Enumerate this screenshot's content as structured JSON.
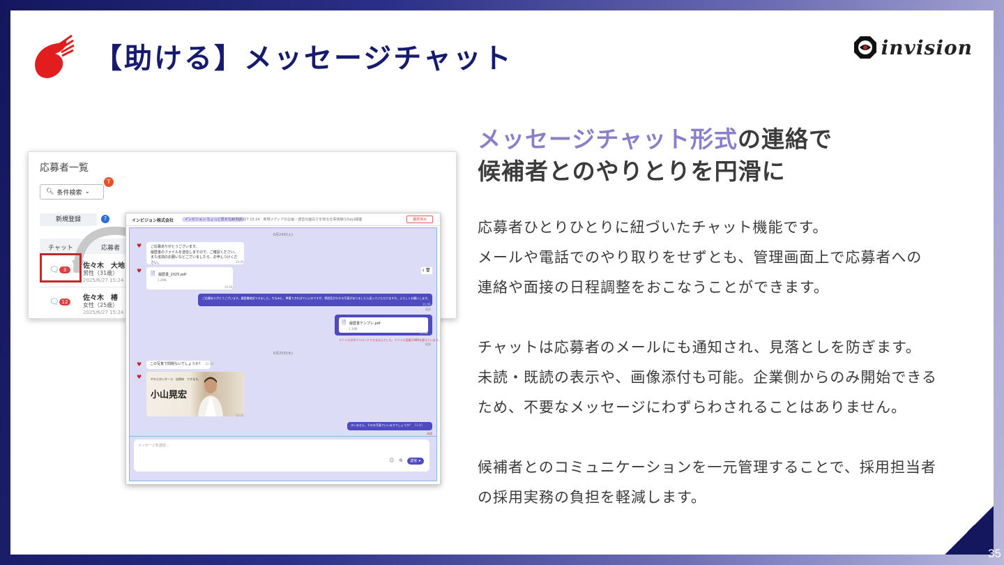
{
  "slide": {
    "title": "【助ける】メッセージチャット",
    "brand": "invision",
    "page_number": "35",
    "colors": {
      "navy": "#161b6e",
      "accent": "#8b7fc9",
      "logo_red": "#e11d1d"
    }
  },
  "headline": {
    "accent": "メッセージチャット形式",
    "line1_rest": "の連絡で",
    "line2": "候補者とのやりとりを円滑に"
  },
  "body": {
    "p1": [
      "応募者ひとりひとりに紐づいたチャット機能です。",
      "メールや電話でのやり取りをせずとも、管理画面上で応募者への",
      "連絡や面接の日程調整をおこなうことができます。"
    ],
    "p2": [
      "チャットは応募者のメールにも通知され、見落としを防ぎます。",
      "未読・既読の表示や、画像添付も可能。企業側からのみ開始できる",
      "ため、不要なメッセージにわずらわされることはありません。"
    ],
    "p3": [
      "候補者とのコミュニケーションを一元管理することで、採用担当者",
      "の採用実務の負担を軽減します。"
    ]
  },
  "applicant_list": {
    "title": "応募者一覧",
    "search_button": "条件検索",
    "badge": "T",
    "new_button": "新規登録",
    "help": "?",
    "headers": [
      "チャット",
      "応募者"
    ],
    "rows": [
      {
        "count": "3",
        "name": "佐々木　大地",
        "gender": "男性（31歳）",
        "date": "2025/6/27 15:24"
      },
      {
        "count": "12",
        "name": "佐々木　椿",
        "gender": "女性（25歳）",
        "date": "2025/6/27 15:24"
      }
    ]
  },
  "chat": {
    "company": "インビジョン株式会社",
    "tag": "インビジョン ちょっと見せちゃうよ",
    "info": "2025/6/27 15:24　新規メディアの企画・運営の面白さを知る仕事体験(1Day)開催",
    "action": "選択済み",
    "date1": "6月24日(火)",
    "msg1": [
      "ご応募ありがとうございます。",
      "履歴書のファイルを送信しますので、ご確認ください。",
      "また追加のお願いなどございましたら、お申しつけください。"
    ],
    "msg1_time": "10:25",
    "file1": "履歴書_2025.pdf",
    "file1_size": "1.2MB",
    "file1_time": "10:26",
    "msg2": "ご応募ありがとうございます。履歴書確認できました。ちなみに、準備できればでいいのですが、雰囲気がわかる写真がありましたら送っていただけますか。よろしくお願いします。",
    "msg2_time": "11:05",
    "read": "既読",
    "file2": "履歴書テンプレ.pdf",
    "file2_size": "2.1MB",
    "file2_time": "11:06",
    "file2_note": "ファイルがダウンロードできませんでした。ファイル容量10MBを超えています。",
    "date2": "6月25日(水)",
    "msg3": "この写真で問題ないでしょうか？",
    "msg3_time": "12:10",
    "photo_caption": "やわらかいオーラ　自然体　ですます。",
    "photo_name": "小山晃宏",
    "photo_time": "12:25",
    "msg4": "すいません、そのお写真でいいますでしょうか？",
    "msg4_time": "13:10",
    "unread": "未読",
    "input_placeholder": "メッセージを送信...",
    "send": "送信"
  }
}
